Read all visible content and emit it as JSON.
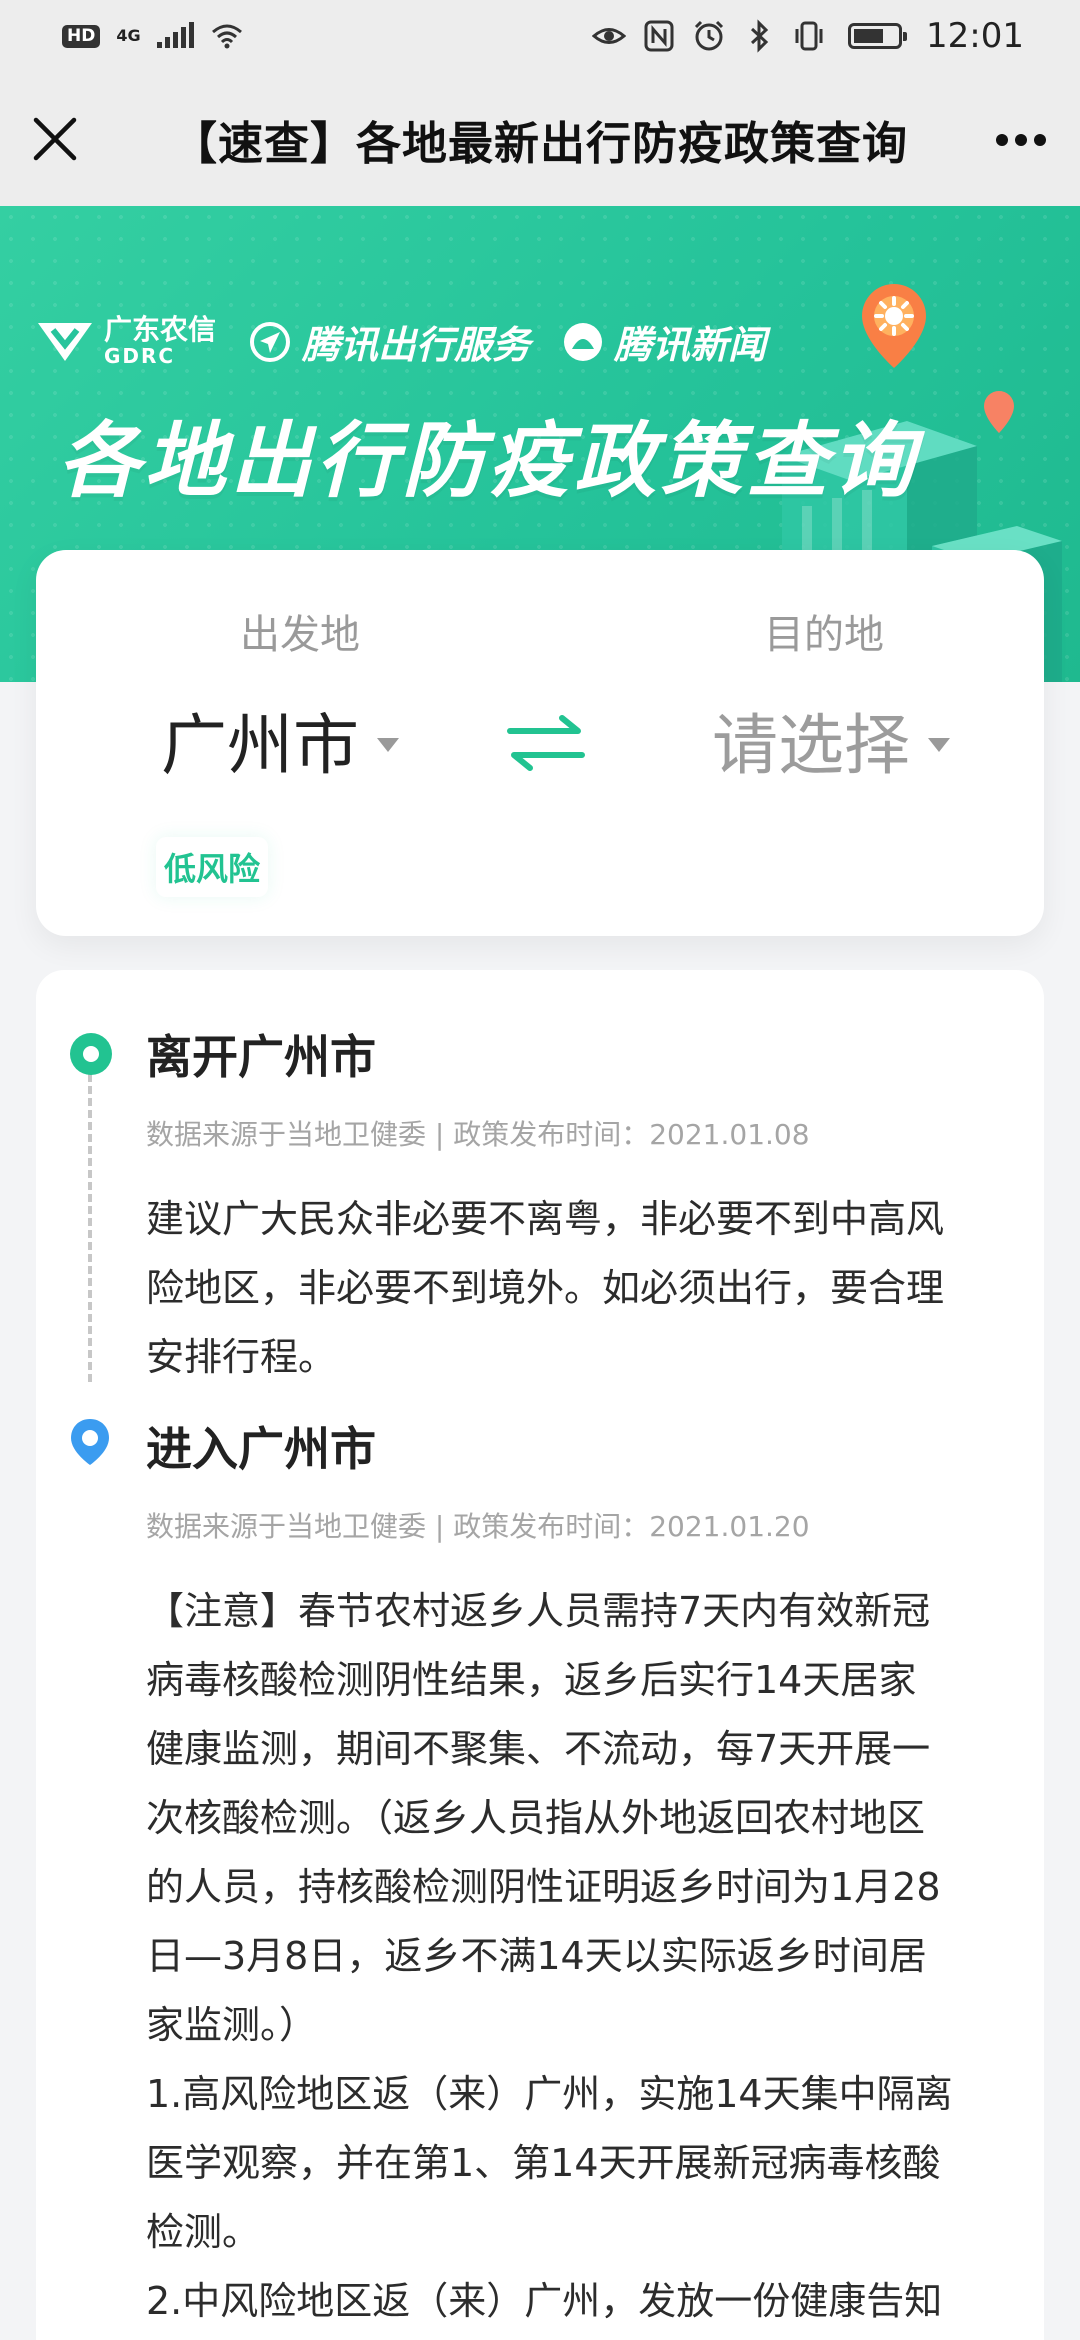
{
  "status_bar": {
    "hd": "HD",
    "network": "4G",
    "time": "12:01"
  },
  "nav": {
    "title": "【速查】各地最新出行防疫政策查询"
  },
  "hero": {
    "brand_gdrc_cn": "广东农信",
    "brand_gdrc_en": "GDRC",
    "brand_travel": "腾讯出行服务",
    "brand_news": "腾讯新闻",
    "title": "各地出行防疫政策查询"
  },
  "route": {
    "from_label": "出发地",
    "to_label": "目的地",
    "from_value": "广州市",
    "to_value": "请选择",
    "risk_level": "低风险"
  },
  "policies": [
    {
      "title": "离开广州市",
      "meta": "数据来源于当地卫健委 | 政策发布时间：2021.01.08",
      "body": "建议广大民众非必要不离粤，非必要不到中高风\n险地区，非必要不到境外。如必须出行，要合理\n安排行程。"
    },
    {
      "title": "进入广州市",
      "meta": "数据来源于当地卫健委 | 政策发布时间：2021.01.20",
      "body": "【注意】春节农村返乡人员需持7天内有效新冠\n病毒核酸检测阴性结果，返乡后实行14天居家\n健康监测，期间不聚集、不流动，每7天开展一\n次核酸检测。（返乡人员指从外地返回农村地区\n的人员，持核酸检测阴性证明返乡时间为1月28\n日—3月8日，返乡不满14天以实际返乡时间居\n家监测。）\n1.高风险地区返（来）广州，实施14天集中隔离\n医学观察，并在第1、第14天开展新冠病毒核酸\n检测。\n2.中风险地区返（来）广州，发放一份健康告知"
    }
  ],
  "colors": {
    "accent": "#22c391",
    "hero_bg": "#25c39a",
    "pin_blue": "#3b9cf0"
  }
}
